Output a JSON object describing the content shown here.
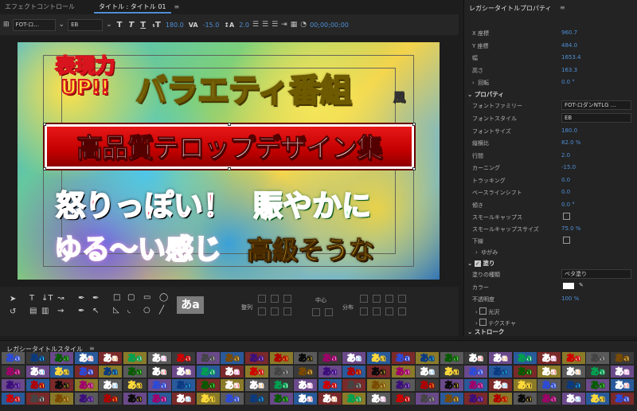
{
  "tabs": {
    "effect_controls": "エフェクトコントロール",
    "title_tab": "タイトル : タイトル 01",
    "menu": "≡"
  },
  "toolbar": {
    "font_family": "FOT-ロ...",
    "font_style": "EB",
    "font_size": "180.0",
    "kerning": "-15.0",
    "leading": "2.0",
    "timecode": "00;00;00;00"
  },
  "canvas": {
    "headline_1": "表現力\nUP!!",
    "headline_2": "バラエティ番組",
    "headline_2_suffix": "風",
    "band_text": "高品質テロップデザイン集",
    "line_angry": "怒りっぽい！",
    "line_lively": "賑やかに",
    "line_loose": "ゆる〜い感じ",
    "line_luxury": "高級そうな"
  },
  "tools": {
    "preview_glyph": "あa",
    "align_label": "整列",
    "center_label": "中心",
    "distribute_label": "分布"
  },
  "properties": {
    "title": "レガシータイトルプロパティ",
    "menu": "≡",
    "transform": [
      {
        "label": "X 座標",
        "value": "960.7"
      },
      {
        "label": "Y 座標",
        "value": "484.0"
      },
      {
        "label": "幅",
        "value": "1653.4"
      },
      {
        "label": "高さ",
        "value": "163.3"
      },
      {
        "label": "回転",
        "value": "0.0 °"
      }
    ],
    "property_header": "プロパティ",
    "font_family_label": "フォントファミリー",
    "font_family_value": "FOT-ロダンNTLG ...",
    "font_style_label": "フォントスタイル",
    "font_style_value": "EB",
    "rows": [
      {
        "label": "フォントサイズ",
        "value": "180.0"
      },
      {
        "label": "縦横比",
        "value": "82.0 %"
      },
      {
        "label": "行間",
        "value": "2.0"
      },
      {
        "label": "カーニング",
        "value": "-15.0"
      },
      {
        "label": "トラッキング",
        "value": "0.0"
      },
      {
        "label": "ベースラインシフト",
        "value": "0.0"
      },
      {
        "label": "傾き",
        "value": "0.0 °"
      }
    ],
    "small_caps_label": "スモールキャップス",
    "small_caps_size_label": "スモールキャップスサイズ",
    "small_caps_size_value": "75.0 %",
    "underline_label": "下線",
    "distort_label": "ゆがみ",
    "fill_header": "塗り",
    "fill_type_label": "塗りの種類",
    "fill_type_value": "ベタ塗り",
    "color_label": "カラー",
    "opacity_label": "不透明度",
    "opacity_value": "100 %",
    "sheen_label": "光沢",
    "texture_label": "テクスチャ",
    "stroke_header": "ストローク"
  },
  "styles": {
    "title": "レガシータイトルスタイル",
    "menu": "≡",
    "glyph": "あa"
  },
  "colors": {
    "accent": "#4f8fd6",
    "panel": "#232323",
    "band_red": "#d10000"
  }
}
